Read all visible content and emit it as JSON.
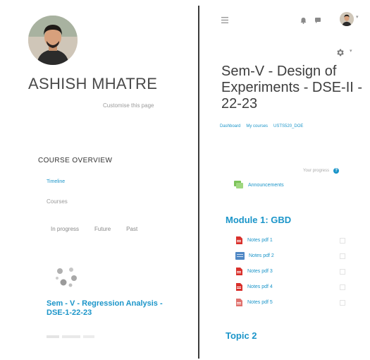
{
  "profile": {
    "name": "ASHISH MHATRE",
    "customise_label": "Customise this page"
  },
  "overview": {
    "heading": "COURSE OVERVIEW",
    "timeline_label": "Timeline",
    "courses_label": "Courses",
    "tabs": [
      {
        "label": "In progress"
      },
      {
        "label": "Future"
      },
      {
        "label": "Past"
      }
    ],
    "course": {
      "title": "Sem - V - Regression Analysis - DSE-1-22-23"
    }
  },
  "course_page": {
    "title": "Sem-V - Design of Experiments - DSE-II - 22-23",
    "breadcrumb": [
      "Dashboard",
      "My courses",
      "USTS520_DOE"
    ],
    "progress_label": "Your progress",
    "announcements_label": "Announcements",
    "sections": [
      {
        "title": "Module 1: GBD",
        "resources": [
          {
            "label": "Notes pdf 1",
            "icon": "pdf-icon"
          },
          {
            "label": "Notes pdf 2",
            "icon": "file-icon"
          },
          {
            "label": "Notes pdf 3",
            "icon": "pdf-icon"
          },
          {
            "label": "Notes pdf 4",
            "icon": "pdf-icon"
          },
          {
            "label": "Notes pdf 5",
            "icon": "pdf-icon"
          }
        ]
      },
      {
        "title": "Topic 2",
        "resources": []
      }
    ]
  },
  "colors": {
    "link": "#1b95c9",
    "text": "#444444",
    "pdf_red": "#d9302b",
    "forum_green": "#7cc35a"
  }
}
